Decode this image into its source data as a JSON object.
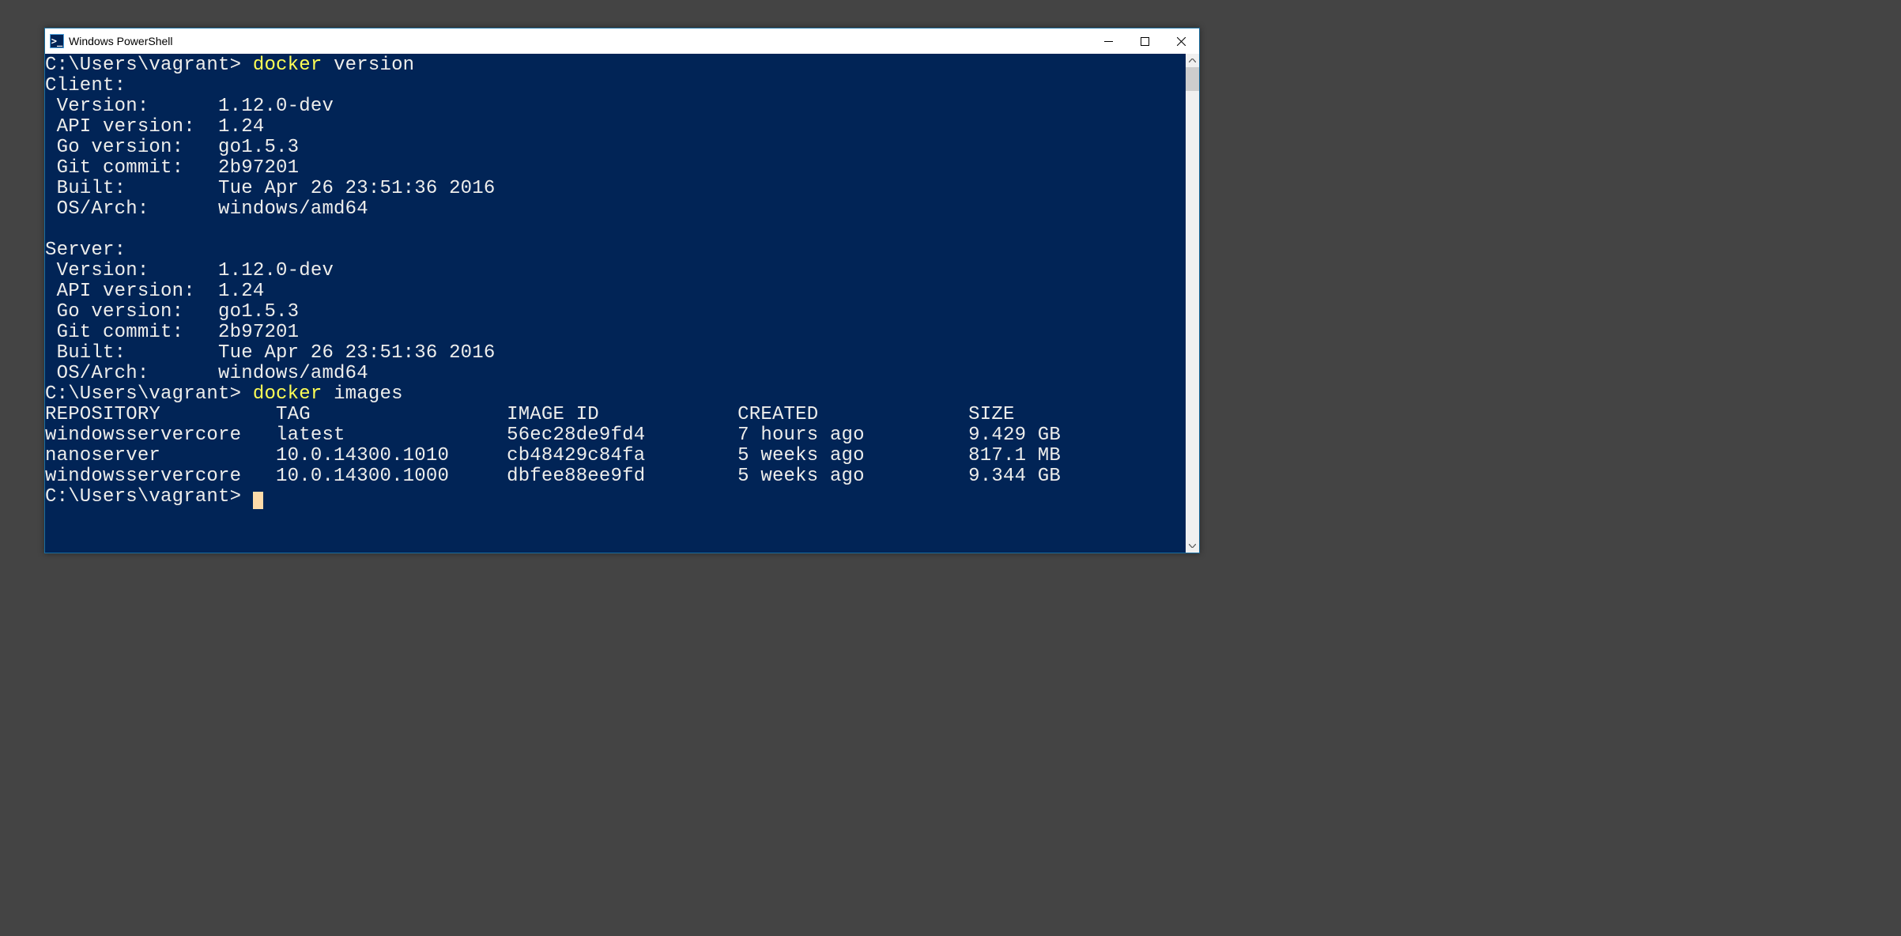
{
  "window": {
    "title": "Windows PowerShell",
    "icon_glyph": ">_"
  },
  "colors": {
    "terminal_bg": "#012456",
    "terminal_fg": "#eeeeec",
    "command_fg": "#ffff55",
    "outer_bg": "#444444"
  },
  "terminal": {
    "prompt": "C:\\Users\\vagrant> ",
    "commands": [
      {
        "binary": "docker",
        "args": " version"
      },
      {
        "binary": "docker",
        "args": " images"
      }
    ],
    "version_output": {
      "client_header": "Client:",
      "server_header": "Server:",
      "client": {
        "l1": " Version:      1.12.0-dev",
        "l2": " API version:  1.24",
        "l3": " Go version:   go1.5.3",
        "l4": " Git commit:   2b97201",
        "l5": " Built:        Tue Apr 26 23:51:36 2016",
        "l6": " OS/Arch:      windows/amd64"
      },
      "server": {
        "l1": " Version:      1.12.0-dev",
        "l2": " API version:  1.24",
        "l3": " Go version:   go1.5.3",
        "l4": " Git commit:   2b97201",
        "l5": " Built:        Tue Apr 26 23:51:36 2016",
        "l6": " OS/Arch:      windows/amd64"
      }
    },
    "images_header": "REPOSITORY          TAG                 IMAGE ID            CREATED             SIZE",
    "images": [
      "windowsservercore   latest              56ec28de9fd4        7 hours ago         9.429 GB",
      "nanoserver          10.0.14300.1010     cb48429c84fa        5 weeks ago         817.1 MB",
      "windowsservercore   10.0.14300.1000     dbfee88ee9fd        5 weeks ago         9.344 GB"
    ]
  }
}
